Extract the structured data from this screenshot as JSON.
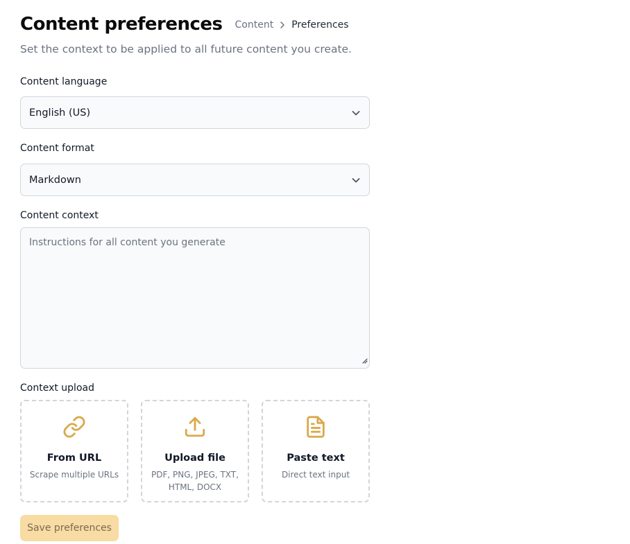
{
  "header": {
    "title": "Content preferences",
    "breadcrumb": {
      "parent": "Content",
      "current": "Preferences"
    },
    "subtitle": "Set the context to be applied to all future content you create."
  },
  "form": {
    "language": {
      "label": "Content language",
      "value": "English (US)"
    },
    "format": {
      "label": "Content format",
      "value": "Markdown"
    },
    "context": {
      "label": "Content context",
      "value": "",
      "placeholder": "Instructions for all content you generate"
    },
    "upload": {
      "label": "Context upload",
      "options": [
        {
          "icon": "link-icon",
          "title": "From URL",
          "description": "Scrape multiple URLs"
        },
        {
          "icon": "upload-icon",
          "title": "Upload file",
          "description": "PDF, PNG, JPEG, TXT, HTML, DOCX"
        },
        {
          "icon": "document-icon",
          "title": "Paste text",
          "description": "Direct text input"
        }
      ]
    }
  },
  "actions": {
    "save_label": "Save preferences"
  },
  "colors": {
    "accent": "#d9a94a",
    "button_bg": "#f8dca3",
    "border": "#d1d5db",
    "field_bg": "#f9fafb"
  }
}
